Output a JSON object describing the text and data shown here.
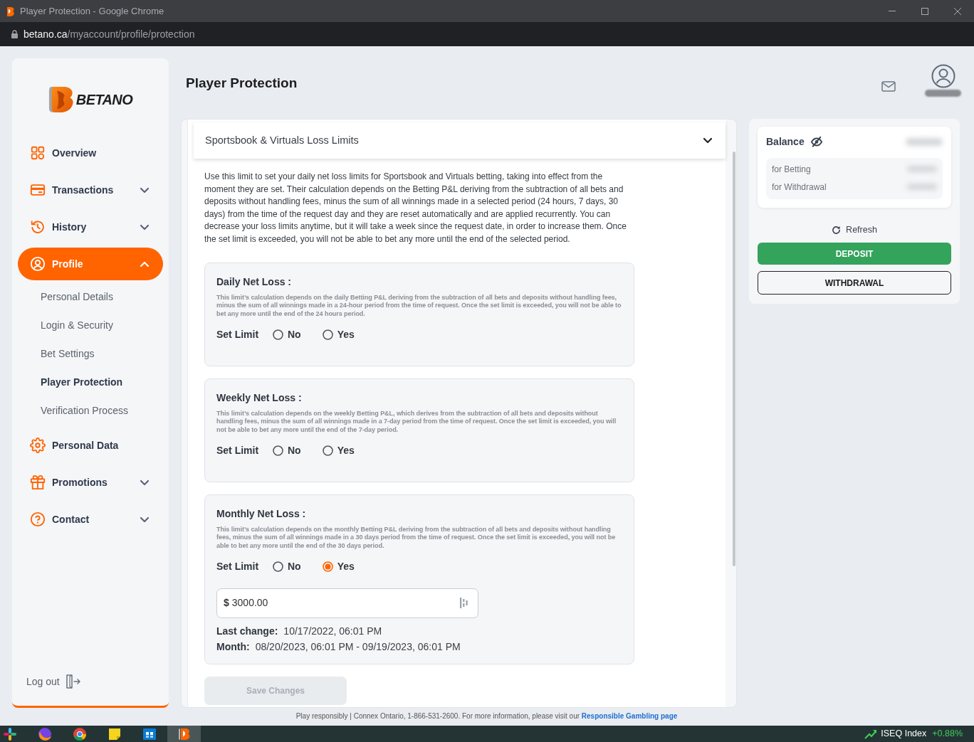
{
  "browser": {
    "title": "Player Protection - Google Chrome",
    "url_domain": "betano.ca",
    "url_path": "/myaccount/profile/protection"
  },
  "sidebar": {
    "logo": "BETANO",
    "items": [
      {
        "label": "Overview",
        "kind": "link",
        "selected": false
      },
      {
        "label": "Transactions",
        "kind": "group",
        "selected": false,
        "expanded": false
      },
      {
        "label": "History",
        "kind": "group",
        "selected": false,
        "expanded": false
      },
      {
        "label": "Profile",
        "kind": "group",
        "selected": true,
        "expanded": true,
        "children": [
          {
            "label": "Personal Details",
            "selected": false
          },
          {
            "label": "Login & Security",
            "selected": false
          },
          {
            "label": "Bet Settings",
            "selected": false
          },
          {
            "label": "Player Protection",
            "selected": true
          },
          {
            "label": "Verification Process",
            "selected": false
          }
        ]
      },
      {
        "label": "Personal Data",
        "kind": "link",
        "selected": false
      },
      {
        "label": "Promotions",
        "kind": "group",
        "selected": false,
        "expanded": false
      },
      {
        "label": "Contact",
        "kind": "group",
        "selected": false,
        "expanded": false
      }
    ],
    "logout": "Log out"
  },
  "page_title": "Player Protection",
  "loss_limits": {
    "title": "Sportsbook & Virtuals Loss Limits",
    "expanded": true,
    "intro": "Use this limit to set your daily net loss limits for Sportsbook and Virtuals betting, taking into effect from the moment they are set. Their calculation depends on the Betting P&L deriving from the subtraction of all bets and deposits without handling fees, minus the sum of all winnings made in a selected period (24 hours, 7 days, 30 days) from the time of the request day and they are reset automatically and are applied recurrently. You can decrease your loss limits anytime, but it will take a week since the request date, in order to increase them. Once the set limit is exceeded, you will not be able to bet any more until the end of the selected period.",
    "limits": [
      {
        "title": "Daily Net Loss :",
        "description": "This limit’s calculation depends on the daily Betting P&L deriving from the subtraction of all bets and deposits without handling fees, minus the sum of all winnings made in a 24-hour period from the time of request. Once the set limit is exceeded, you will not be able to bet any more until the end of the 24 hours period.",
        "set_limit_label": "Set Limit",
        "options": [
          {
            "label": "No",
            "selected": false
          },
          {
            "label": "Yes",
            "selected": false
          }
        ]
      },
      {
        "title": "Weekly Net Loss :",
        "description": "This limit’s calculation depends on the weekly Betting P&L, which derives from the subtraction of all bets and deposits without handling fees, minus the sum of all winnings made in a 7-day period from the time of request. Once the set limit is exceeded, you will not be able to bet any more until the end of the 7-day period.",
        "set_limit_label": "Set Limit",
        "options": [
          {
            "label": "No",
            "selected": false
          },
          {
            "label": "Yes",
            "selected": false
          }
        ]
      },
      {
        "title": "Monthly Net Loss :",
        "description": "This limit’s calculation depends on the monthly Betting P&L deriving from the subtraction of all bets and deposits without handling fees, minus the sum of all winnings made in a 30 days period from the time of request. Once the set limit is exceeded, you will not be able to bet any more until the end of the 30 days period.",
        "set_limit_label": "Set Limit",
        "options": [
          {
            "label": "No",
            "selected": false
          },
          {
            "label": "Yes",
            "selected": true
          }
        ],
        "amount": {
          "currency": "$",
          "value": "3000.00"
        },
        "last_change_label": "Last change:",
        "last_change": "10/17/2022, 06:01 PM",
        "period_label": "Month:",
        "period": "08/20/2023, 06:01 PM - 09/19/2023, 06:01 PM"
      }
    ],
    "save_button": {
      "label": "Save Changes",
      "disabled": true
    }
  },
  "balance": {
    "title": "Balance",
    "rows": [
      {
        "label": "for Betting"
      },
      {
        "label": "for Withdrawal"
      }
    ],
    "refresh": "Refresh",
    "deposit": "DEPOSIT",
    "withdrawal": "WITHDRAWAL"
  },
  "footer": {
    "text": "Play responsibly | Connex Ontario, 1-866-531-2600. For more information, please visit our",
    "link": "Responsible Gambling page"
  },
  "taskbar": {
    "apps": [
      {
        "selected": false
      },
      {
        "selected": false
      },
      {
        "selected": false
      },
      {
        "selected": false
      },
      {
        "selected": false
      },
      {
        "selected": true
      }
    ],
    "ticker": {
      "name": "ISEQ Index",
      "change": "+0.88%"
    }
  }
}
